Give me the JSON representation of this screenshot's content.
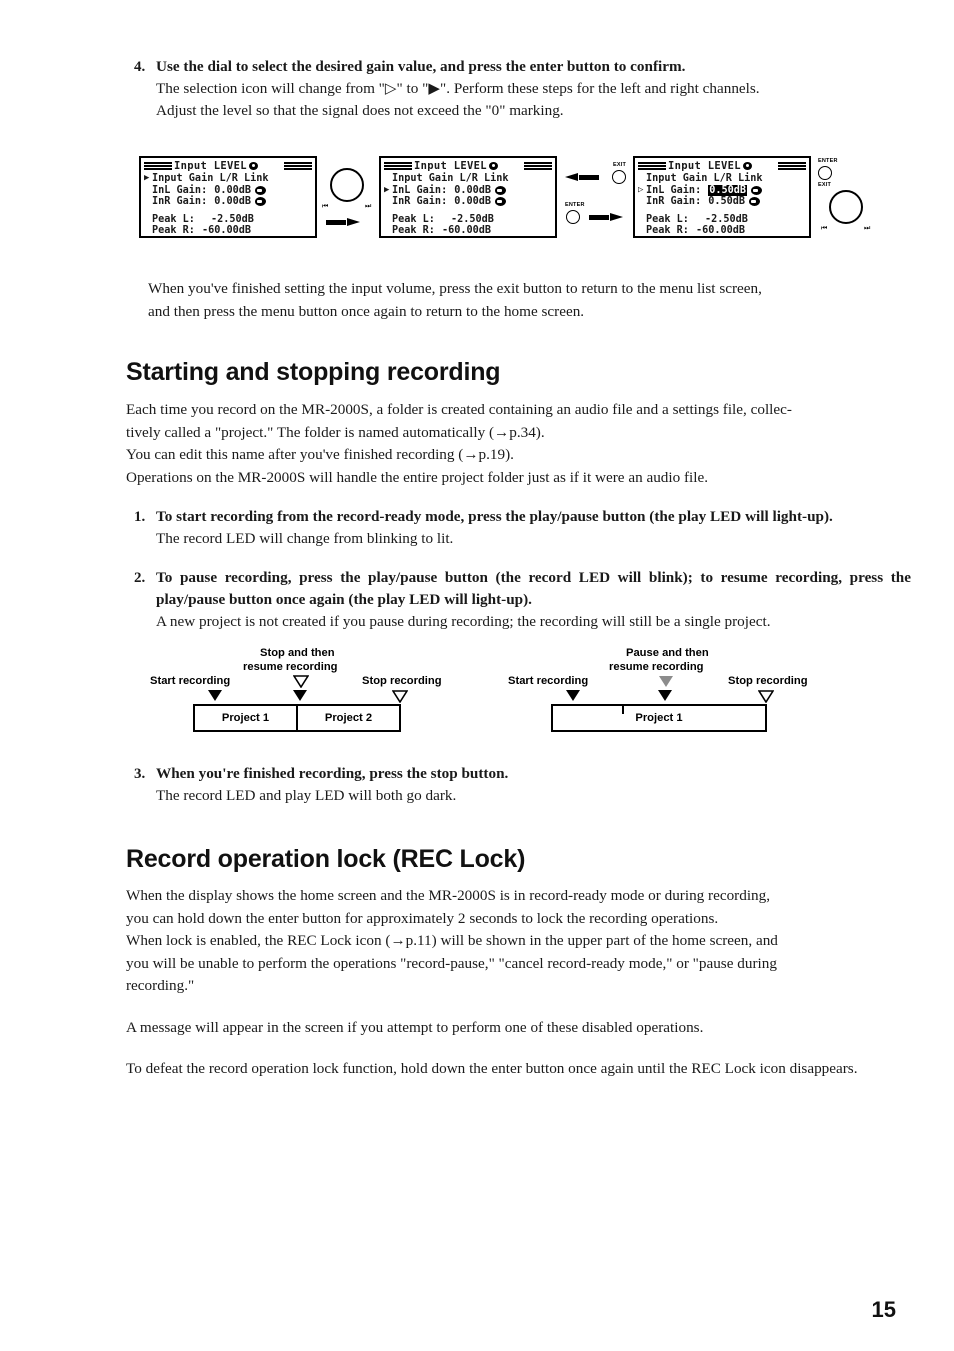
{
  "page": {
    "number": "15"
  },
  "step4": {
    "number": "4.",
    "title": "Use the dial to select the desired gain value, and press the enter button to confirm.",
    "body_line1": "The selection icon will change from \"▷\" to \"▶\". Perform these steps for the left and right channels.",
    "body_line2": "Adjust the level so that the signal does not exceed the \"0\" marking."
  },
  "lcd_figure": {
    "screens": [
      {
        "title": "Input LEVEL",
        "cursor_row": 0,
        "rows": [
          {
            "label": "Input Gain L/R Link",
            "value": "",
            "knob": false
          },
          {
            "label": "InL Gain:",
            "value": "0.00dB",
            "knob": true
          },
          {
            "label": "InR Gain:",
            "value": "0.00dB",
            "knob": true
          }
        ],
        "peaks": [
          {
            "label": "Peak L:",
            "value": "-2.50dB"
          },
          {
            "label": "Peak R:",
            "value": "-60.00dB"
          }
        ],
        "highlight_row": -1,
        "cursor_glyph": "▶"
      },
      {
        "title": "Input LEVEL",
        "cursor_row": 1,
        "rows": [
          {
            "label": "Input Gain L/R Link",
            "value": "",
            "knob": false
          },
          {
            "label": "InL Gain:",
            "value": "0.00dB",
            "knob": true
          },
          {
            "label": "InR Gain:",
            "value": "0.00dB",
            "knob": true
          }
        ],
        "peaks": [
          {
            "label": "Peak L:",
            "value": "-2.50dB"
          },
          {
            "label": "Peak R:",
            "value": "-60.00dB"
          }
        ],
        "highlight_row": -1,
        "cursor_glyph": "▶"
      },
      {
        "title": "Input LEVEL",
        "cursor_row": 1,
        "rows": [
          {
            "label": "Input Gain L/R Link",
            "value": "",
            "knob": false
          },
          {
            "label": "InL Gain:",
            "value": "0.50dB",
            "knob": true
          },
          {
            "label": "InR Gain:",
            "value": "0.50dB",
            "knob": true
          }
        ],
        "peaks": [
          {
            "label": "Peak L:",
            "value": "-2.50dB"
          },
          {
            "label": "Peak R:",
            "value": "-60.00dB"
          }
        ],
        "highlight_row": 1,
        "cursor_glyph": "▷"
      }
    ],
    "controls": {
      "exit_label": "EXIT",
      "enter_label": "ENTER",
      "rew_glyph": "⏮",
      "ff_glyph": "⏭"
    }
  },
  "after_figure": {
    "line1": "When you've finished setting the input volume, press the exit button to return to the menu list screen,",
    "line2": "and then press the menu button once again to return to the home screen."
  },
  "section_recording": {
    "heading": "Starting and stopping recording",
    "intro_line1": "Each time you record on the MR-2000S, a folder is created containing an audio file and a settings file, collec-",
    "intro_line2": "tively called a \"project.\" The folder is named automatically (→p.34).",
    "intro_line3": "You can edit this name after you've finished recording (→p.19).",
    "intro_line4": "Operations on the MR-2000S will handle the entire project folder just as if it were an audio file.",
    "steps": [
      {
        "number": "1.",
        "title": "To start recording from the record-ready mode, press the play/pause button (the play LED will light-up).",
        "body": "The record LED will change from blinking to lit."
      },
      {
        "number": "2.",
        "title": "To pause recording, press the play/pause button (the record LED will blink); to resume recording, press the play/pause button once again (the play LED will light-up).",
        "body": "A new project is not created if you pause during recording; the recording will still be a single project."
      },
      {
        "number": "3.",
        "title": "When you're finished recording, press the stop button.",
        "body": "The record LED and play LED will both go dark."
      }
    ]
  },
  "timeline_figure": {
    "left": {
      "start_label": "Start recording",
      "middle_label_line1": "Stop and then",
      "middle_label_line2": "resume recording",
      "stop_label": "Stop recording",
      "cells": [
        "Project 1",
        "Project 2"
      ],
      "middle_marker_style": "hollow-over-filled"
    },
    "right": {
      "start_label": "Start recording",
      "middle_label_line1": "Pause and then",
      "middle_label_line2": "resume recording",
      "stop_label": "Stop recording",
      "cells": [
        "Project 1"
      ],
      "middle_marker_style": "gray-over-filled"
    }
  },
  "section_reclock": {
    "heading": "Record operation lock (REC Lock)",
    "para1_line1": "When the display shows the home screen and the MR-2000S is in record-ready mode or during recording,",
    "para1_line2": "you can hold down the enter button for approximately 2 seconds to lock the recording operations.",
    "para1_line3": "When lock is enabled, the REC Lock icon (→p.11) will be shown in the upper part of the home screen, and",
    "para1_line4": "you will be unable to perform the operations \"record-pause,\" \"cancel record-ready mode,\" or \"pause during",
    "para1_line5": "recording.\"",
    "para2": "A message will appear in the screen if you attempt to perform one of these disabled operations.",
    "para3": "To defeat the record operation lock function, hold down the enter button once again until the REC Lock icon disappears."
  }
}
